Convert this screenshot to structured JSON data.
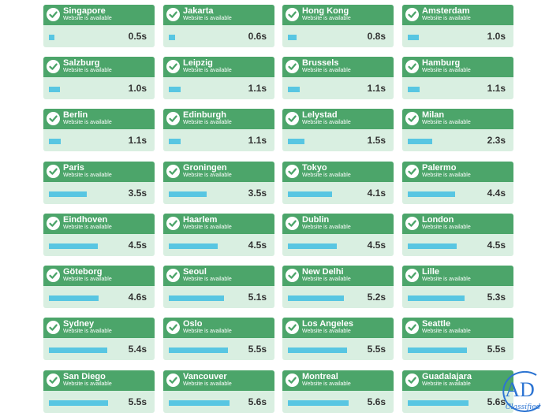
{
  "colors": {
    "header": "#4ca56a",
    "card": "#d9efe1",
    "bar": "#58c6e2",
    "watermark": "#2c74d2"
  },
  "icons": {
    "status": "check-circle-icon"
  },
  "scale_max_seconds": 6.0,
  "locations": [
    {
      "city": "Singapore",
      "status": "Website is available",
      "time": "0.5s",
      "seconds": 0.5
    },
    {
      "city": "Jakarta",
      "status": "Website is available",
      "time": "0.6s",
      "seconds": 0.6
    },
    {
      "city": "Hong Kong",
      "status": "Website is available",
      "time": "0.8s",
      "seconds": 0.8
    },
    {
      "city": "Amsterdam",
      "status": "Website is available",
      "time": "1.0s",
      "seconds": 1.0
    },
    {
      "city": "Salzburg",
      "status": "Website is available",
      "time": "1.0s",
      "seconds": 1.0
    },
    {
      "city": "Leipzig",
      "status": "Website is available",
      "time": "1.1s",
      "seconds": 1.1
    },
    {
      "city": "Brussels",
      "status": "Website is available",
      "time": "1.1s",
      "seconds": 1.1
    },
    {
      "city": "Hamburg",
      "status": "Website is available",
      "time": "1.1s",
      "seconds": 1.1
    },
    {
      "city": "Berlin",
      "status": "Website is available",
      "time": "1.1s",
      "seconds": 1.1
    },
    {
      "city": "Edinburgh",
      "status": "Website is available",
      "time": "1.1s",
      "seconds": 1.1
    },
    {
      "city": "Lelystad",
      "status": "Website is available",
      "time": "1.5s",
      "seconds": 1.5
    },
    {
      "city": "Milan",
      "status": "Website is available",
      "time": "2.3s",
      "seconds": 2.3
    },
    {
      "city": "Paris",
      "status": "Website is available",
      "time": "3.5s",
      "seconds": 3.5
    },
    {
      "city": "Groningen",
      "status": "Website is available",
      "time": "3.5s",
      "seconds": 3.5
    },
    {
      "city": "Tokyo",
      "status": "Website is available",
      "time": "4.1s",
      "seconds": 4.1
    },
    {
      "city": "Palermo",
      "status": "Website is available",
      "time": "4.4s",
      "seconds": 4.4
    },
    {
      "city": "Eindhoven",
      "status": "Website is available",
      "time": "4.5s",
      "seconds": 4.5
    },
    {
      "city": "Haarlem",
      "status": "Website is available",
      "time": "4.5s",
      "seconds": 4.5
    },
    {
      "city": "Dublin",
      "status": "Website is available",
      "time": "4.5s",
      "seconds": 4.5
    },
    {
      "city": "London",
      "status": "Website is available",
      "time": "4.5s",
      "seconds": 4.5
    },
    {
      "city": "Göteborg",
      "status": "Website is available",
      "time": "4.6s",
      "seconds": 4.6
    },
    {
      "city": "Seoul",
      "status": "Website is available",
      "time": "5.1s",
      "seconds": 5.1
    },
    {
      "city": "New Delhi",
      "status": "Website is available",
      "time": "5.2s",
      "seconds": 5.2
    },
    {
      "city": "Lille",
      "status": "Website is available",
      "time": "5.3s",
      "seconds": 5.3
    },
    {
      "city": "Sydney",
      "status": "Website is available",
      "time": "5.4s",
      "seconds": 5.4
    },
    {
      "city": "Oslo",
      "status": "Website is available",
      "time": "5.5s",
      "seconds": 5.5
    },
    {
      "city": "Los Angeles",
      "status": "Website is available",
      "time": "5.5s",
      "seconds": 5.5
    },
    {
      "city": "Seattle",
      "status": "Website is available",
      "time": "5.5s",
      "seconds": 5.5
    },
    {
      "city": "San Diego",
      "status": "Website is available",
      "time": "5.5s",
      "seconds": 5.5
    },
    {
      "city": "Vancouver",
      "status": "Website is available",
      "time": "5.6s",
      "seconds": 5.6
    },
    {
      "city": "Montreal",
      "status": "Website is available",
      "time": "5.6s",
      "seconds": 5.6
    },
    {
      "city": "Guadalajara",
      "status": "Website is available",
      "time": "5.6s",
      "seconds": 5.6
    }
  ],
  "watermark": {
    "letters": "AD",
    "word": "Classified"
  }
}
